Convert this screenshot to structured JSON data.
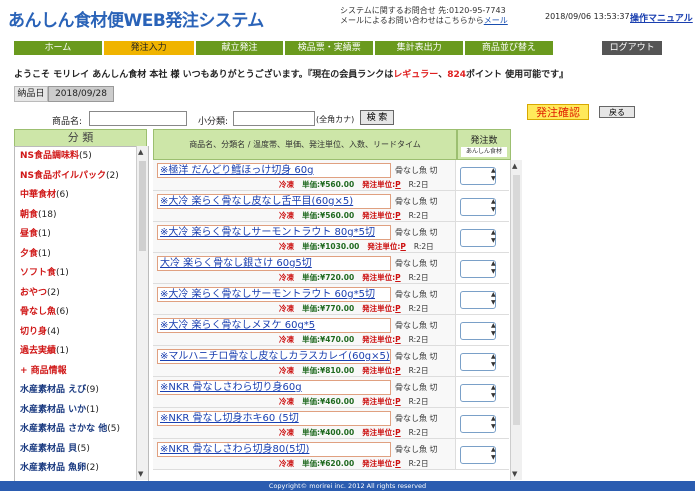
{
  "header": {
    "brand": "あんしん食材便WEB発注システム",
    "contact_line1": "システムに関するお問合せ 先:0120-95-7743",
    "contact_line2_prefix": "メールによるお問い合わせはこちらから",
    "contact_link": "メール",
    "datetime": "2018/09/06 13:53:37",
    "manual": "操作マニュアル"
  },
  "nav": {
    "tabs": [
      "ホーム",
      "発注入力",
      "献立発注",
      "検品票・実績票",
      "集計表出力",
      "商品並び替え"
    ],
    "logout": "ログアウト"
  },
  "welcome": {
    "prefix": "ようこそ モリレイ あんしん食材 本社 様 いつもありがとうございます。『現在の会員ランクは",
    "rank": "レギュラー",
    "middle": "、",
    "points": "824",
    "suffix": "ポイント 使用可能です』"
  },
  "delivery": {
    "label": "納品日",
    "date": "2018/09/28"
  },
  "search": {
    "name_label": "商品名:",
    "name_value": "",
    "sub_label": "小分類:",
    "sub_value": "",
    "sub_hint": "(全角カナ)",
    "button": "検 索"
  },
  "actions": {
    "confirm": "発注確認",
    "back": "戻る"
  },
  "categories": {
    "header": "分 類",
    "items": [
      {
        "label": "NS食品調味料",
        "count": "(5)",
        "style": "red"
      },
      {
        "label": "NS食品ボイルパック",
        "count": "(2)",
        "style": "red"
      },
      {
        "label": "中華食材",
        "count": "(6)",
        "style": "red"
      },
      {
        "label": "朝食",
        "count": "(18)",
        "style": "red"
      },
      {
        "label": "昼食",
        "count": "(1)",
        "style": "red"
      },
      {
        "label": "夕食",
        "count": "(1)",
        "style": "red"
      },
      {
        "label": "ソフト食",
        "count": "(1)",
        "style": "red"
      },
      {
        "label": "おやつ",
        "count": "(2)",
        "style": "red"
      },
      {
        "label": "骨なし魚",
        "count": "(6)",
        "style": "red"
      },
      {
        "label": "切り身",
        "count": "(4)",
        "style": "red"
      },
      {
        "label": "過去実績",
        "count": "(1)",
        "style": "red"
      },
      {
        "label": "+ 商品情報",
        "count": "",
        "style": "red"
      },
      {
        "label": "水産素材品 えび",
        "count": "(9)",
        "style": "blue"
      },
      {
        "label": "水産素材品 いか",
        "count": "(1)",
        "style": "blue"
      },
      {
        "label": "水産素材品 さかな 他",
        "count": "(5)",
        "style": "blue"
      },
      {
        "label": "水産素材品 貝",
        "count": "(5)",
        "style": "blue"
      },
      {
        "label": "水産素材品 魚卵",
        "count": "(2)",
        "style": "blue"
      }
    ]
  },
  "table": {
    "product_header": "商品名、分類名 / 温度帯、単価、発注単位、入数、リードタイム",
    "qty_header": "発注数",
    "qty_subheader": "あんしん食材"
  },
  "products": [
    {
      "name": "※極洋 だんどり鱈ほっけ切身 60g",
      "category": "骨なし魚 切",
      "temp": "冷凍",
      "price": "単価:¥560.00",
      "unit_label": "発注単位:",
      "unit": "P",
      "lead": "R:2日"
    },
    {
      "name": "※大冷 楽らく骨なし皮なし舌平目(60g×5)",
      "category": "骨なし魚 切",
      "temp": "冷凍",
      "price": "単価:¥560.00",
      "unit_label": "発注単位:",
      "unit": "P",
      "lead": "R:2日"
    },
    {
      "name": "※大冷 楽らく骨なしサーモントラウト 80g*5切",
      "category": "骨なし魚 切",
      "temp": "冷凍",
      "price": "単価:¥1030.00",
      "unit_label": "発注単位:",
      "unit": "P",
      "lead": "R:2日"
    },
    {
      "name": "大冷 楽らく骨なし銀さけ 60g5切",
      "category": "骨なし魚 切",
      "temp": "冷凍",
      "price": "単価:¥720.00",
      "unit_label": "発注単位:",
      "unit": "P",
      "lead": "R:2日"
    },
    {
      "name": "※大冷 楽らく骨なしサーモントラウト 60g*5切",
      "category": "骨なし魚 切",
      "temp": "冷凍",
      "price": "単価:¥770.00",
      "unit_label": "発注単位:",
      "unit": "P",
      "lead": "R:2日"
    },
    {
      "name": "※大冷 楽らく骨なしメヌケ 60g*5",
      "category": "骨なし魚 切",
      "temp": "冷凍",
      "price": "単価:¥470.00",
      "unit_label": "発注単位:",
      "unit": "P",
      "lead": "R:2日"
    },
    {
      "name": "※マルハニチロ骨なし皮なしカラスカレイ(60g×5)",
      "category": "骨なし魚 切",
      "temp": "冷凍",
      "price": "単価:¥810.00",
      "unit_label": "発注単位:",
      "unit": "P",
      "lead": "R:2日"
    },
    {
      "name": "※NKR 骨なしさわら切り身60g",
      "category": "骨なし魚 切",
      "temp": "冷凍",
      "price": "単価:¥460.00",
      "unit_label": "発注単位:",
      "unit": "P",
      "lead": "R:2日"
    },
    {
      "name": "※NKR 骨なし切身ホキ60 (5切",
      "category": "骨なし魚 切",
      "temp": "冷凍",
      "price": "単価:¥400.00",
      "unit_label": "発注単位:",
      "unit": "P",
      "lead": "R:2日"
    },
    {
      "name": "※NKR 骨なしさわら切身80(5切)",
      "category": "骨なし魚 切",
      "temp": "冷凍",
      "price": "単価:¥620.00",
      "unit_label": "発注単位:",
      "unit": "P",
      "lead": "R:2日"
    }
  ],
  "footer": {
    "copyright": "Copyright© morirei inc. 2012 All rights reserved"
  },
  "colors": {
    "nav": "#6a9a1e",
    "nav_active": "#f0b400",
    "brand": "#2a63b8",
    "footer": "#2b5cb0",
    "accent_red": "#e02020"
  }
}
